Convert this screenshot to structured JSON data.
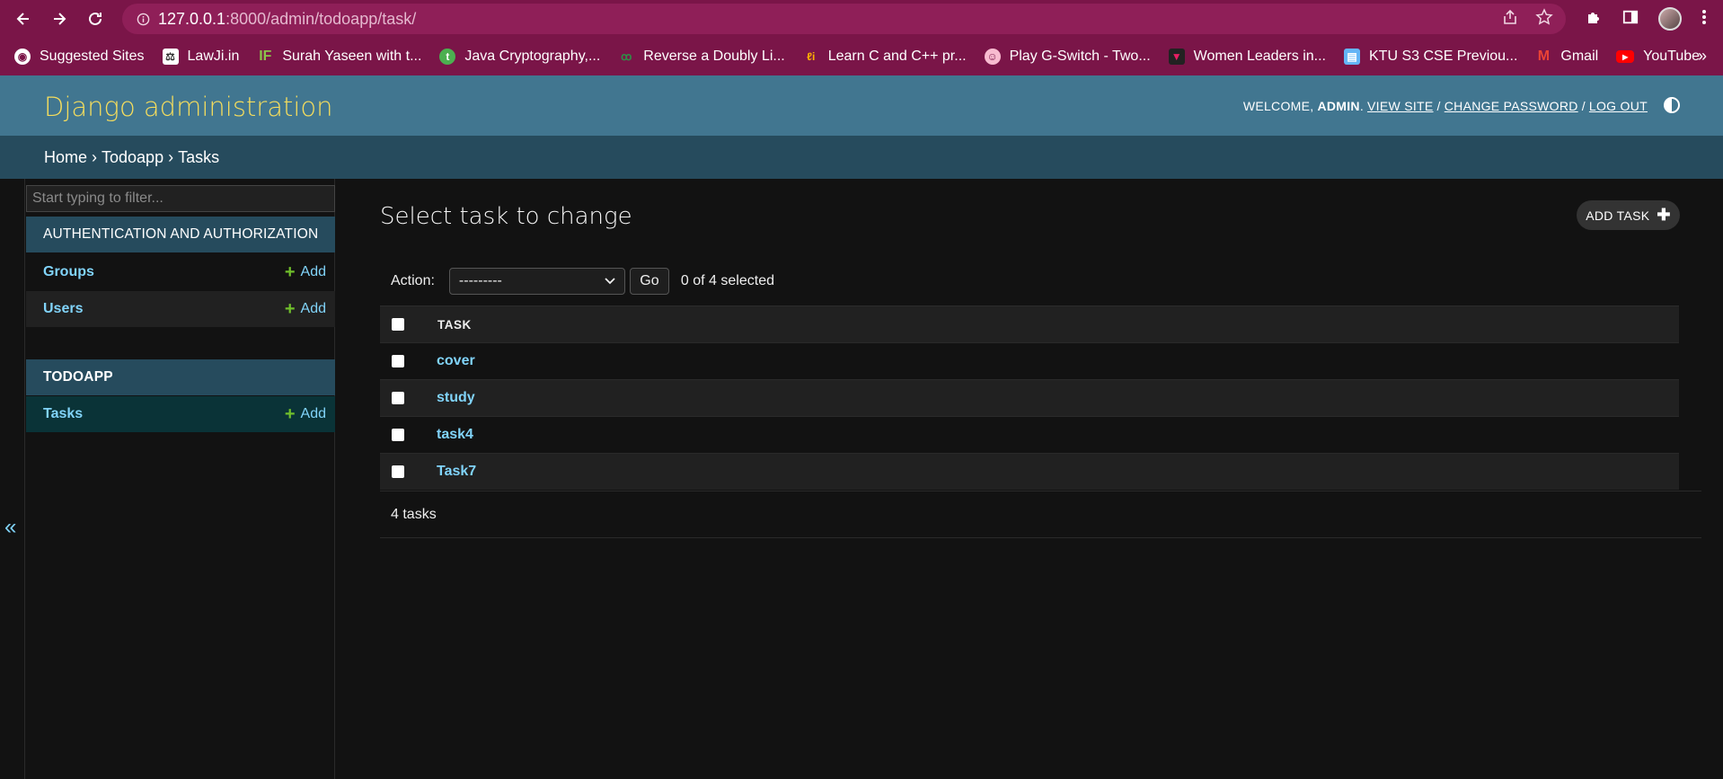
{
  "browser": {
    "url_host": "127.0.0.1",
    "url_rest": ":8000/admin/todoapp/task/",
    "bookmarks": [
      {
        "label": "Suggested Sites",
        "icon": "globe-icon",
        "color": "#ffffff"
      },
      {
        "label": "LawJi.in",
        "icon": "scales-icon",
        "color": "#ffffff"
      },
      {
        "label": "Surah Yaseen with t...",
        "icon": "if-icon",
        "color": "#8bc34a"
      },
      {
        "label": "Java Cryptography,...",
        "icon": "tp-icon",
        "color": "#4caf50"
      },
      {
        "label": "Reverse a Doubly Li...",
        "icon": "gfg-icon",
        "color": "#2f8d46"
      },
      {
        "label": "Learn C and C++ pr...",
        "icon": "learn-icon",
        "color": "#ffb300"
      },
      {
        "label": "Play G-Switch - Two...",
        "icon": "game-icon",
        "color": "#f8bbd0"
      },
      {
        "label": "Women Leaders in...",
        "icon": "shield-icon",
        "color": "#222222"
      },
      {
        "label": "KTU S3 CSE Previou...",
        "icon": "book-icon",
        "color": "#64b5f6"
      },
      {
        "label": "Gmail",
        "icon": "gmail-icon",
        "color": "#ea4335"
      },
      {
        "label": "YouTube",
        "icon": "youtube-icon",
        "color": "#ff0000"
      }
    ]
  },
  "header": {
    "branding": "Django administration",
    "welcome": "WELCOME,",
    "username": "ADMIN",
    "view_site": "VIEW SITE",
    "change_password": "CHANGE PASSWORD",
    "log_out": "LOG OUT"
  },
  "breadcrumbs": {
    "home": "Home",
    "app": "Todoapp",
    "current": "Tasks",
    "sep": "›"
  },
  "sidebar": {
    "filter_placeholder": "Start typing to filter...",
    "apps": [
      {
        "caption": "AUTHENTICATION AND AUTHORIZATION",
        "models": [
          {
            "label": "Groups",
            "add": "Add"
          },
          {
            "label": "Users",
            "add": "Add"
          }
        ]
      },
      {
        "caption": "TODOAPP",
        "models": [
          {
            "label": "Tasks",
            "add": "Add"
          }
        ]
      }
    ],
    "collapse": "«"
  },
  "main": {
    "title": "Select task to change",
    "add_button": "ADD TASK",
    "action_label": "Action:",
    "action_selected": "---------",
    "go_label": "Go",
    "selected_count": "0 of 4 selected",
    "column_header": "TASK",
    "tasks": [
      "cover",
      "study",
      "task4",
      "Task7"
    ],
    "paginator": "4 tasks"
  },
  "colors": {
    "chrome": "#7a1548",
    "header_bg": "#417690",
    "branding": "#f5dd5d",
    "breadcrumbs_bg": "#264b5d",
    "link": "#81d4fa",
    "add_plus": "#70bf2b"
  }
}
